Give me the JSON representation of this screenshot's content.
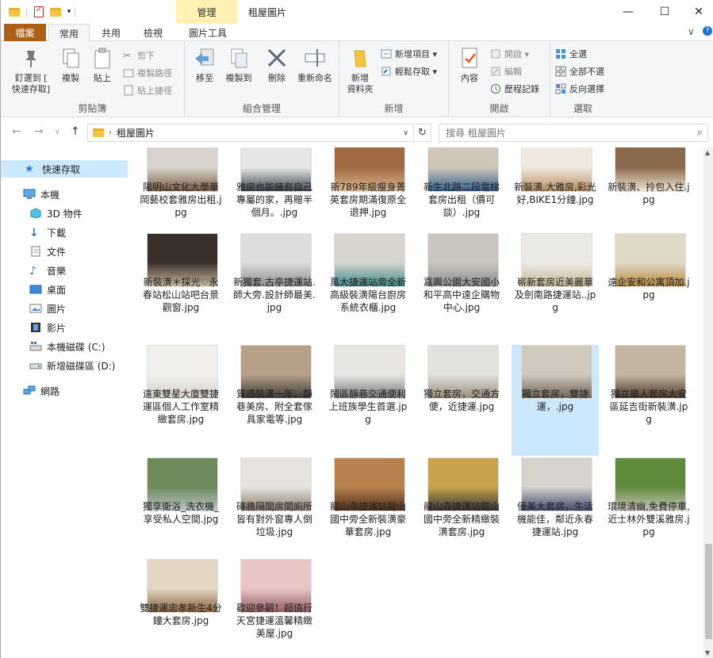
{
  "window": {
    "title": "租屋圖片",
    "contextual_tab_group": "管理",
    "controls": {
      "minimize": "—",
      "maximize": "☐",
      "close": "✕"
    }
  },
  "ribbon_tabs": [
    "檔案",
    "常用",
    "共用",
    "檢視",
    "圖片工具"
  ],
  "ribbon_right": {
    "collapse": "∨",
    "help": "?"
  },
  "clipboard": {
    "label": "剪貼簿",
    "pin": "釘選到 [\n快速存取]",
    "copy": "複製",
    "paste": "貼上",
    "cut": "剪下",
    "copy_path": "複製路徑",
    "paste_shortcut": "貼上捷徑"
  },
  "organize": {
    "label": "組合管理",
    "move_to": "移至",
    "copy_to": "複製到",
    "delete": "刪除",
    "rename": "重新命名"
  },
  "new_group": {
    "label": "新增",
    "new_folder": "新增\n資料夾",
    "new_item": "新增項目 ▾",
    "easy_access": "輕鬆存取 ▾"
  },
  "open_group": {
    "label": "開啟",
    "properties": "內容",
    "open": "開啟 ▾",
    "edit": "編輯",
    "history": "歷程記錄"
  },
  "select_group": {
    "label": "選取",
    "select_all": "全選",
    "select_none": "全部不選",
    "invert": "反向選擇"
  },
  "address": {
    "path": "租屋圖片",
    "search_placeholder": "搜尋 租屋圖片"
  },
  "nav_pane": {
    "quick_access": "快速存取",
    "this_pc": "本機",
    "objects_3d": "3D 物件",
    "downloads": "下載",
    "documents": "文件",
    "music": "音樂",
    "desktop": "桌面",
    "pictures": "圖片",
    "videos": "影片",
    "drive_c": "本機磁碟 (C:)",
    "drive_d": "新增磁碟區 (D:)",
    "network": "網路"
  },
  "files": [
    {
      "name": "陽明山文化大學華岡藝校套雅房出租.jpg",
      "colors": [
        "#d7d2cb",
        "#7c5c44"
      ]
    },
    {
      "name": "雅房也能擁有自己專屬的家，再贈半個月。.jpg",
      "colors": [
        "#e6e6e4",
        "#3b4550"
      ]
    },
    {
      "name": "新789年級瘦身菁英套房期滿復原全退押.jpg",
      "colors": [
        "#a06a44",
        "#d8b58c"
      ]
    },
    {
      "name": "新生北路二段電梯套房出租（價可談）.jpg",
      "colors": [
        "#cfc6b8",
        "#2f5f8f"
      ]
    },
    {
      "name": "新裝潢,大雅房,彩光好,BIKE1分鐘.jpg",
      "colors": [
        "#efe9df",
        "#b88d62"
      ]
    },
    {
      "name": "新裝潢、拎包入住.jpg",
      "colors": [
        "#8a6a4c",
        "#f1e6d4"
      ]
    },
    {
      "name": "新裝潢＊採光♡永春站松山站吧台景觀窗.jpg",
      "colors": [
        "#3a302a",
        "#c9b7a0"
      ]
    },
    {
      "name": "新獨套.古亭捷運站.師大旁.設計師最美.jpg",
      "colors": [
        "#dcdcdc",
        "#8c8f92"
      ]
    },
    {
      "name": "萬大捷運站旁全新高級裝潢陽台廚房系統衣櫃.jpg",
      "colors": [
        "#d7d4ce",
        "#3c8a8d"
      ]
    },
    {
      "name": "嘉興公園大安國小和平高中遠企購物中心.jpg",
      "colors": [
        "#c9c5be",
        "#8b8e91"
      ]
    },
    {
      "name": "嶄新套房近美麗華及劍南路捷運站..jpg",
      "colors": [
        "#eceae6",
        "#c7b796"
      ]
    },
    {
      "name": "遠企安和公寓頂加.jpg",
      "colors": [
        "#e1d9c7",
        "#b6883e"
      ]
    },
    {
      "name": "遠東雙星大廈雙捷運區個人工作室精緻套房.jpg",
      "colors": [
        "#f1f0ec",
        "#d6d2c9"
      ]
    },
    {
      "name": "質感裝潢一年、靜巷美房、附全套傢具家電等.jpg",
      "colors": [
        "#b7a08a",
        "#3d3a36"
      ]
    },
    {
      "name": "鬧區靜巷交通便利上班族學生首選.jpg",
      "colors": [
        "#e8e6e3",
        "#777777"
      ]
    },
    {
      "name": "獨立套房，交通方便，近捷運.jpg",
      "colors": [
        "#e2e2de",
        "#9a8d7d"
      ]
    },
    {
      "name": "獨立套房，雙捷運，.jpg",
      "colors": [
        "#cfc8bd",
        "#6f6354"
      ],
      "selected": true
    },
    {
      "name": "獨立單人套房大安區延吉街新裝潢.jpg",
      "colors": [
        "#c4b5a3",
        "#4d3a2c"
      ]
    },
    {
      "name": "獨享衛浴_洗衣機_享受私人空間.jpg",
      "colors": [
        "#6f8a5c",
        "#b9c3c6"
      ]
    },
    {
      "name": "磚牆隔間房間廁所皆有對外窗專人倒垃圾.jpg",
      "colors": [
        "#e6e3de",
        "#8a7b6b"
      ]
    },
    {
      "name": "龍山寺捷運站龍山國中旁全新裝潢豪華套房.jpg",
      "colors": [
        "#b8814e",
        "#4e2f1c"
      ]
    },
    {
      "name": "龍山寺捷運站龍山國中旁全新精緻裝潢套房.jpg",
      "colors": [
        "#c9a24d",
        "#333333"
      ]
    },
    {
      "name": "優美大套房，生活機能佳，鄰近永春捷運站.jpg",
      "colors": [
        "#d6d3ce",
        "#3f4a6a"
      ]
    },
    {
      "name": "環境清幽,免費停車,近士林外雙溪雅房.jpg",
      "colors": [
        "#5f8a3a",
        "#c9c4bb"
      ]
    },
    {
      "name": "雙捷運忠孝新生4分鐘大套房.jpg",
      "colors": [
        "#e3d6c2",
        "#8a6443"
      ]
    },
    {
      "name": "歡迎參觀！超值行天宮捷運溫馨精緻美屋.jpg",
      "colors": [
        "#e9c6c6",
        "#8f5d5d"
      ]
    }
  ]
}
